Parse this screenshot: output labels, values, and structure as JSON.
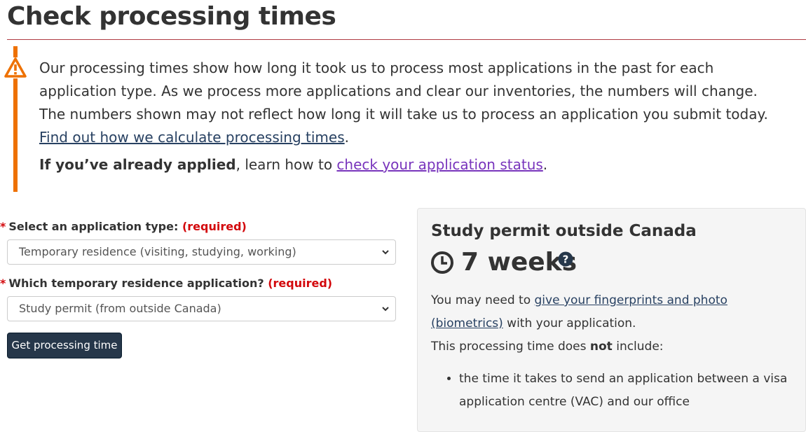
{
  "page": {
    "title": "Check processing times"
  },
  "notice": {
    "text_1": "Our processing times show how long it took us to process most applications in the past for each application type. As we process more applications and clear our inventories, the numbers will change. The numbers shown may not reflect how long it will take us to process an application you submit today. ",
    "link_calc": "Find out how we calculate processing times",
    "period_1": ".",
    "applied_bold": "If you’ve already applied",
    "applied_text": ", learn how to ",
    "link_status": "check your application status",
    "period_2": ".",
    "icon": "warning-icon",
    "accent_color": "#ee7100"
  },
  "form": {
    "field1": {
      "star": "*",
      "label": "Select an application type:",
      "required": "(required)",
      "value": "Temporary residence (visiting, studying, working)"
    },
    "field2": {
      "star": "*",
      "label": "Which temporary residence application?",
      "required": "(required)",
      "value": "Study permit (from outside Canada)"
    },
    "submit_label": "Get processing time"
  },
  "result": {
    "title": "Study permit outside Canada",
    "time": "7 weeks",
    "intro_pre": "You may need to ",
    "link_biometrics": "give your fingerprints and photo (biometrics)",
    "intro_post": " with your application.",
    "excl_pre": "This processing time does ",
    "excl_bold": "not",
    "excl_post": " include:",
    "items": [
      "the time it takes to send an application between a visa application centre (VAC) and our office"
    ]
  },
  "colors": {
    "title_rule": "#af3c43",
    "link": "#284162",
    "link_visited": "#7834bc",
    "required": "#d3080c",
    "button_bg": "#26374a"
  }
}
